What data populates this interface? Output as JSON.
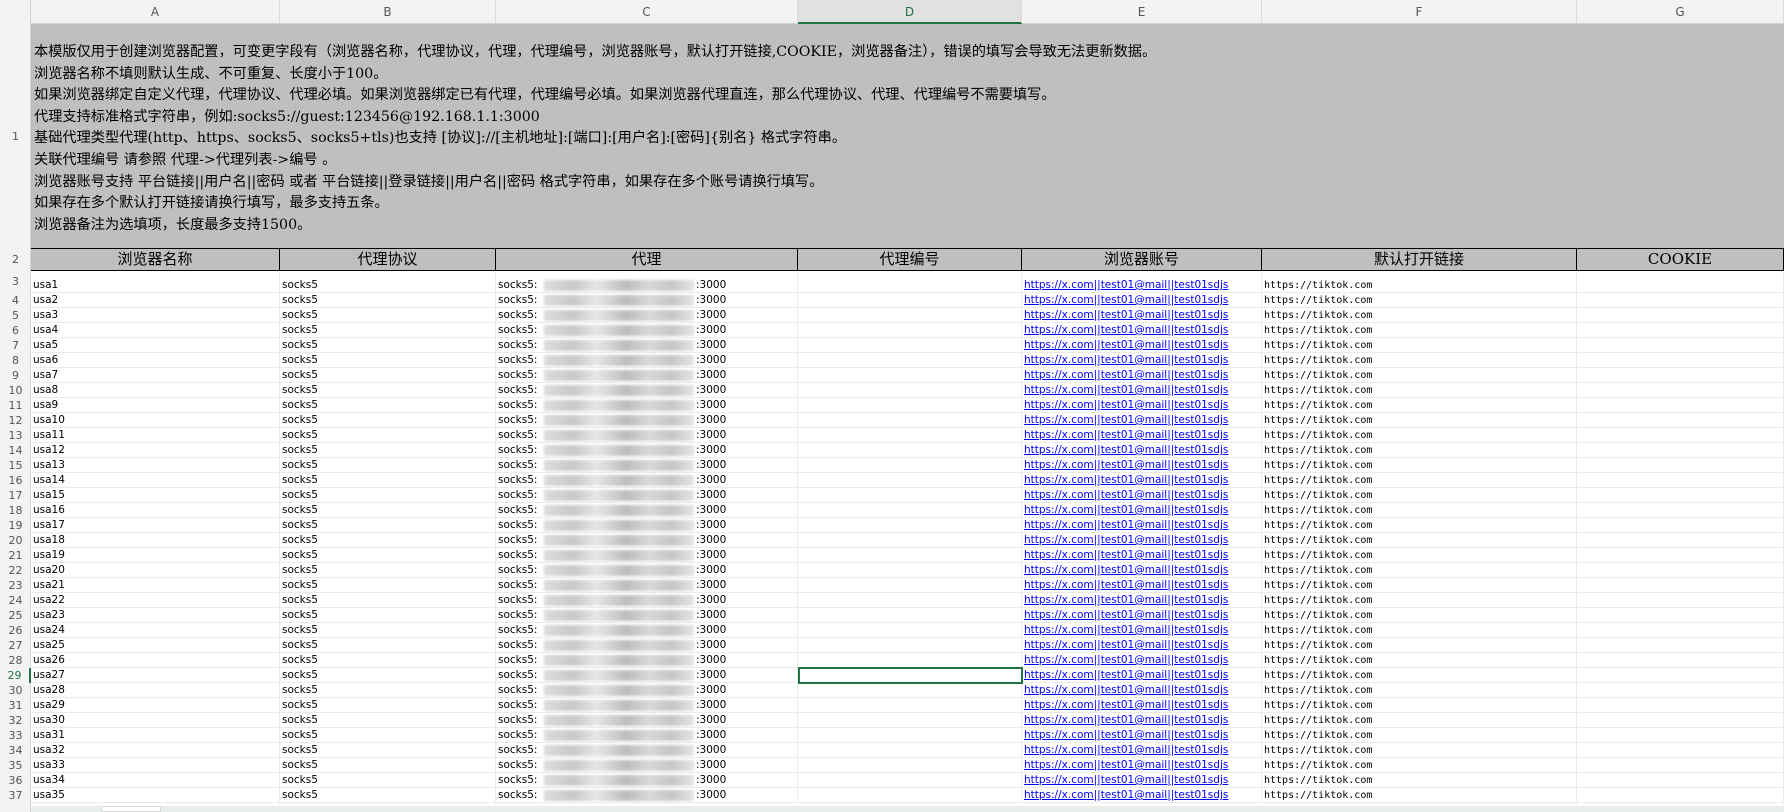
{
  "sheet": {
    "columns": [
      "A",
      "B",
      "C",
      "D",
      "E",
      "F",
      "G"
    ],
    "selected_column": "D",
    "selected_row": "29",
    "notes": [
      "本模版仅用于创建浏览器配置，可变更字段有（浏览器名称，代理协议，代理，代理编号，浏览器账号，默认打开链接,COOKIE，浏览器备注），错误的填写会导致无法更新数据。",
      "浏览器名称不填则默认生成、不可重复、长度小于100。",
      "如果浏览器绑定自定义代理，代理协议、代理必填。如果浏览器绑定已有代理，代理编号必填。如果浏览器代理直连，那么代理协议、代理、代理编号不需要填写。",
      "代理支持标准格式字符串，例如:socks5://guest:123456@192.168.1.1:3000",
      "基础代理类型代理(http、https、socks5、socks5+tls)也支持 [协议]://[主机地址]:[端口]:[用户名]:[密码]{别名} 格式字符串。",
      "关联代理编号 请参照 代理->代理列表->编号 。",
      "浏览器账号支持 平台链接||用户名||密码 或者 平台链接||登录链接||用户名||密码 格式字符串，如果存在多个账号请换行填写。",
      "如果存在多个默认打开链接请换行填写，最多支持五条。",
      "浏览器备注为选填项，长度最多支持1500。"
    ],
    "headers": [
      "浏览器名称",
      "代理协议",
      "代理",
      "代理编号",
      "浏览器账号",
      "默认打开链接",
      "COOKIE"
    ],
    "rows": [
      {
        "row": "3",
        "name": "usa1",
        "protocol": "socks5",
        "proxy_prefix": "socks5:",
        "proxy_port": ":3000",
        "account": "https://x.com||test01@mail||test01sdjs",
        "open_link": "https://tiktok.com"
      },
      {
        "row": "4",
        "name": "usa2",
        "protocol": "socks5",
        "proxy_prefix": "socks5:",
        "proxy_port": ":3000",
        "account": "https://x.com||test01@mail||test01sdjs",
        "open_link": "https://tiktok.com"
      },
      {
        "row": "5",
        "name": "usa3",
        "protocol": "socks5",
        "proxy_prefix": "socks5:",
        "proxy_port": ":3000",
        "account": "https://x.com||test01@mail||test01sdjs",
        "open_link": "https://tiktok.com"
      },
      {
        "row": "6",
        "name": "usa4",
        "protocol": "socks5",
        "proxy_prefix": "socks5:",
        "proxy_port": ":3000",
        "account": "https://x.com||test01@mail||test01sdjs",
        "open_link": "https://tiktok.com"
      },
      {
        "row": "7",
        "name": "usa5",
        "protocol": "socks5",
        "proxy_prefix": "socks5:",
        "proxy_port": ":3000",
        "account": "https://x.com||test01@mail||test01sdjs",
        "open_link": "https://tiktok.com"
      },
      {
        "row": "8",
        "name": "usa6",
        "protocol": "socks5",
        "proxy_prefix": "socks5:",
        "proxy_port": ":3000",
        "account": "https://x.com||test01@mail||test01sdjs",
        "open_link": "https://tiktok.com"
      },
      {
        "row": "9",
        "name": "usa7",
        "protocol": "socks5",
        "proxy_prefix": "socks5:",
        "proxy_port": ":3000",
        "account": "https://x.com||test01@mail||test01sdjs",
        "open_link": "https://tiktok.com"
      },
      {
        "row": "10",
        "name": "usa8",
        "protocol": "socks5",
        "proxy_prefix": "socks5:",
        "proxy_port": ":3000",
        "account": "https://x.com||test01@mail||test01sdjs",
        "open_link": "https://tiktok.com"
      },
      {
        "row": "11",
        "name": "usa9",
        "protocol": "socks5",
        "proxy_prefix": "socks5:",
        "proxy_port": ":3000",
        "account": "https://x.com||test01@mail||test01sdjs",
        "open_link": "https://tiktok.com"
      },
      {
        "row": "12",
        "name": "usa10",
        "protocol": "socks5",
        "proxy_prefix": "socks5:",
        "proxy_port": ":3000",
        "account": "https://x.com||test01@mail||test01sdjs",
        "open_link": "https://tiktok.com"
      },
      {
        "row": "13",
        "name": "usa11",
        "protocol": "socks5",
        "proxy_prefix": "socks5:",
        "proxy_port": ":3000",
        "account": "https://x.com||test01@mail||test01sdjs",
        "open_link": "https://tiktok.com"
      },
      {
        "row": "14",
        "name": "usa12",
        "protocol": "socks5",
        "proxy_prefix": "socks5:",
        "proxy_port": ":3000",
        "account": "https://x.com||test01@mail||test01sdjs",
        "open_link": "https://tiktok.com"
      },
      {
        "row": "15",
        "name": "usa13",
        "protocol": "socks5",
        "proxy_prefix": "socks5:",
        "proxy_port": ":3000",
        "account": "https://x.com||test01@mail||test01sdjs",
        "open_link": "https://tiktok.com"
      },
      {
        "row": "16",
        "name": "usa14",
        "protocol": "socks5",
        "proxy_prefix": "socks5:",
        "proxy_port": ":3000",
        "account": "https://x.com||test01@mail||test01sdjs",
        "open_link": "https://tiktok.com"
      },
      {
        "row": "17",
        "name": "usa15",
        "protocol": "socks5",
        "proxy_prefix": "socks5:",
        "proxy_port": ":3000",
        "account": "https://x.com||test01@mail||test01sdjs",
        "open_link": "https://tiktok.com"
      },
      {
        "row": "18",
        "name": "usa16",
        "protocol": "socks5",
        "proxy_prefix": "socks5:",
        "proxy_port": ":3000",
        "account": "https://x.com||test01@mail||test01sdjs",
        "open_link": "https://tiktok.com"
      },
      {
        "row": "19",
        "name": "usa17",
        "protocol": "socks5",
        "proxy_prefix": "socks5:",
        "proxy_port": ":3000",
        "account": "https://x.com||test01@mail||test01sdjs",
        "open_link": "https://tiktok.com"
      },
      {
        "row": "20",
        "name": "usa18",
        "protocol": "socks5",
        "proxy_prefix": "socks5:",
        "proxy_port": ":3000",
        "account": "https://x.com||test01@mail||test01sdjs",
        "open_link": "https://tiktok.com"
      },
      {
        "row": "21",
        "name": "usa19",
        "protocol": "socks5",
        "proxy_prefix": "socks5:",
        "proxy_port": ":3000",
        "account": "https://x.com||test01@mail||test01sdjs",
        "open_link": "https://tiktok.com"
      },
      {
        "row": "22",
        "name": "usa20",
        "protocol": "socks5",
        "proxy_prefix": "socks5:",
        "proxy_port": ":3000",
        "account": "https://x.com||test01@mail||test01sdjs",
        "open_link": "https://tiktok.com"
      },
      {
        "row": "23",
        "name": "usa21",
        "protocol": "socks5",
        "proxy_prefix": "socks5:",
        "proxy_port": ":3000",
        "account": "https://x.com||test01@mail||test01sdjs",
        "open_link": "https://tiktok.com"
      },
      {
        "row": "24",
        "name": "usa22",
        "protocol": "socks5",
        "proxy_prefix": "socks5:",
        "proxy_port": ":3000",
        "account": "https://x.com||test01@mail||test01sdjs",
        "open_link": "https://tiktok.com"
      },
      {
        "row": "25",
        "name": "usa23",
        "protocol": "socks5",
        "proxy_prefix": "socks5:",
        "proxy_port": ":3000",
        "account": "https://x.com||test01@mail||test01sdjs",
        "open_link": "https://tiktok.com"
      },
      {
        "row": "26",
        "name": "usa24",
        "protocol": "socks5",
        "proxy_prefix": "socks5:",
        "proxy_port": ":3000",
        "account": "https://x.com||test01@mail||test01sdjs",
        "open_link": "https://tiktok.com"
      },
      {
        "row": "27",
        "name": "usa25",
        "protocol": "socks5",
        "proxy_prefix": "socks5:",
        "proxy_port": ":3000",
        "account": "https://x.com||test01@mail||test01sdjs",
        "open_link": "https://tiktok.com"
      },
      {
        "row": "28",
        "name": "usa26",
        "protocol": "socks5",
        "proxy_prefix": "socks5:",
        "proxy_port": ":3000",
        "account": "https://x.com||test01@mail||test01sdjs",
        "open_link": "https://tiktok.com"
      },
      {
        "row": "29",
        "name": "usa27",
        "protocol": "socks5",
        "proxy_prefix": "socks5:",
        "proxy_port": ":3000",
        "account": "https://x.com||test01@mail||test01sdjs",
        "open_link": "https://tiktok.com"
      },
      {
        "row": "30",
        "name": "usa28",
        "protocol": "socks5",
        "proxy_prefix": "socks5:",
        "proxy_port": ":3000",
        "account": "https://x.com||test01@mail||test01sdjs",
        "open_link": "https://tiktok.com"
      },
      {
        "row": "31",
        "name": "usa29",
        "protocol": "socks5",
        "proxy_prefix": "socks5:",
        "proxy_port": ":3000",
        "account": "https://x.com||test01@mail||test01sdjs",
        "open_link": "https://tiktok.com"
      },
      {
        "row": "32",
        "name": "usa30",
        "protocol": "socks5",
        "proxy_prefix": "socks5:",
        "proxy_port": ":3000",
        "account": "https://x.com||test01@mail||test01sdjs",
        "open_link": "https://tiktok.com"
      },
      {
        "row": "33",
        "name": "usa31",
        "protocol": "socks5",
        "proxy_prefix": "socks5:",
        "proxy_port": ":3000",
        "account": "https://x.com||test01@mail||test01sdjs",
        "open_link": "https://tiktok.com"
      },
      {
        "row": "34",
        "name": "usa32",
        "protocol": "socks5",
        "proxy_prefix": "socks5:",
        "proxy_port": ":3000",
        "account": "https://x.com||test01@mail||test01sdjs",
        "open_link": "https://tiktok.com"
      },
      {
        "row": "35",
        "name": "usa33",
        "protocol": "socks5",
        "proxy_prefix": "socks5:",
        "proxy_port": ":3000",
        "account": "https://x.com||test01@mail||test01sdjs",
        "open_link": "https://tiktok.com"
      },
      {
        "row": "36",
        "name": "usa34",
        "protocol": "socks5",
        "proxy_prefix": "socks5:",
        "proxy_port": ":3000",
        "account": "https://x.com||test01@mail||test01sdjs",
        "open_link": "https://tiktok.com"
      },
      {
        "row": "37",
        "name": "usa35",
        "protocol": "socks5",
        "proxy_prefix": "socks5:",
        "proxy_port": ":3000",
        "account": "https://x.com||test01@mail||test01sdjs",
        "open_link": "https://tiktok.com"
      }
    ],
    "colors": {
      "accent": "#217346",
      "header_fill": "#bfbfbf",
      "link": "#0000ff"
    }
  }
}
